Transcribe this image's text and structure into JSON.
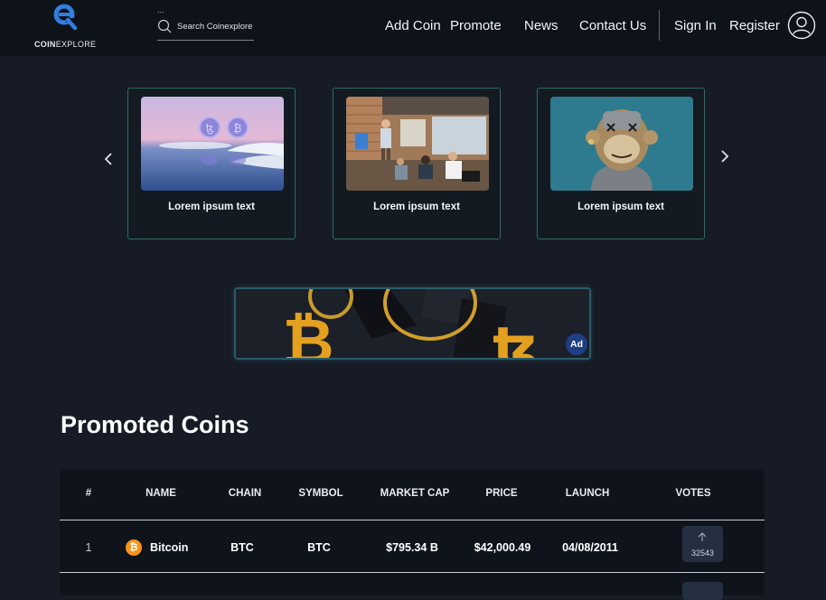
{
  "header": {
    "logo": {
      "brand_bold": "COIN",
      "brand_light": "EXPLORE"
    },
    "search": {
      "placeholder": "Search Coinexplore",
      "dots": "..."
    },
    "nav": [
      {
        "label": "Add Coin"
      },
      {
        "label": "Promote"
      },
      {
        "label": "News"
      },
      {
        "label": "Contact Us"
      }
    ],
    "sign_in": "Sign In",
    "register": "Register"
  },
  "carousel": {
    "cards": [
      {
        "label": "Lorem ipsum text"
      },
      {
        "label": "Lorem ipsum text"
      },
      {
        "label": "Lorem ipsum text"
      }
    ]
  },
  "ad": {
    "badge": "Ad"
  },
  "promoted": {
    "title": "Promoted Coins",
    "columns": [
      "#",
      "NAME",
      "CHAIN",
      "SYMBOL",
      "MARKET CAP",
      "PRICE",
      "LAUNCH",
      "VOTES"
    ],
    "rows": [
      {
        "index": "1",
        "icon": "bitcoin-icon",
        "icon_glyph": "₿",
        "name": "Bitcoin",
        "chain": "BTC",
        "symbol": "BTC",
        "market_cap": "$795.34 B",
        "price": "$42,000.49",
        "launch": "04/08/2011",
        "votes": "32543"
      }
    ]
  },
  "colors": {
    "background": "#161b25",
    "header": "#0e1219",
    "card_border": "#2e6b6b",
    "accent_blue": "#2f7fe0",
    "bitcoin_orange": "#f7931a"
  }
}
